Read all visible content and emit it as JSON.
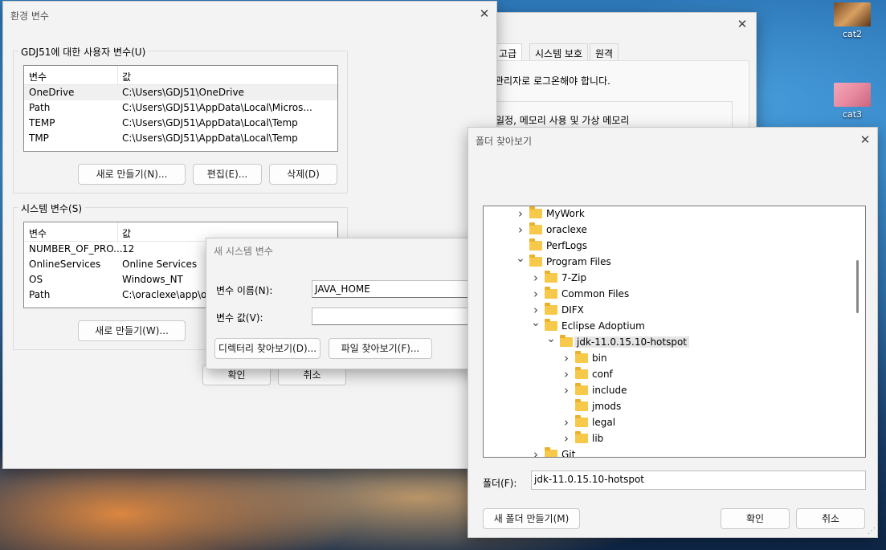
{
  "desktop": {
    "icons": [
      {
        "label": "cat2"
      },
      {
        "label": "cat3"
      }
    ]
  },
  "sysprops": {
    "tabs": [
      "고급",
      "시스템 보호",
      "원격"
    ],
    "admin_note": "관리자로 로그온해야 합니다.",
    "perf_note": "일정, 메모리 사용 및 가상 메모리"
  },
  "envvars": {
    "title": "환경 변수",
    "user_group_label": "GDJ51에 대한 사용자 변수(U)",
    "col_var": "변수",
    "col_val": "값",
    "user_rows": [
      {
        "name": "OneDrive",
        "value": "C:\\Users\\GDJ51\\OneDrive"
      },
      {
        "name": "Path",
        "value": "C:\\Users\\GDJ51\\AppData\\Local\\Micros..."
      },
      {
        "name": "TEMP",
        "value": "C:\\Users\\GDJ51\\AppData\\Local\\Temp"
      },
      {
        "name": "TMP",
        "value": "C:\\Users\\GDJ51\\AppData\\Local\\Temp"
      }
    ],
    "user_new": "새로 만들기(N)...",
    "user_edit": "편집(E)...",
    "user_delete": "삭제(D)",
    "sys_group_label": "시스템 변수(S)",
    "sys_rows": [
      {
        "name": "NUMBER_OF_PRO...",
        "value": "12"
      },
      {
        "name": "OnlineServices",
        "value": "Online Services"
      },
      {
        "name": "OS",
        "value": "Windows_NT"
      },
      {
        "name": "Path",
        "value": "C:\\oraclexe\\app\\or"
      }
    ],
    "sys_new": "새로 만들기(W)...",
    "ok": "확인",
    "cancel": "취소"
  },
  "newsysvar": {
    "title": "새 시스템 변수",
    "name_label": "변수 이름(N):",
    "name_value": "JAVA_HOME",
    "value_label": "변수 값(V):",
    "value_value": "",
    "browse_dir": "디렉터리 찾아보기(D)...",
    "browse_file": "파일 찾아보기(F)..."
  },
  "folderbrowse": {
    "title": "폴더 찾아보기",
    "tree": [
      {
        "name": "MyWork",
        "depth": 0,
        "chev": ">"
      },
      {
        "name": "oraclexe",
        "depth": 0,
        "chev": ">"
      },
      {
        "name": "PerfLogs",
        "depth": 0,
        "chev": ""
      },
      {
        "name": "Program Files",
        "depth": 0,
        "chev": "v"
      },
      {
        "name": "7-Zip",
        "depth": 1,
        "chev": ">"
      },
      {
        "name": "Common Files",
        "depth": 1,
        "chev": ">"
      },
      {
        "name": "DIFX",
        "depth": 1,
        "chev": ">"
      },
      {
        "name": "Eclipse Adoptium",
        "depth": 1,
        "chev": "v"
      },
      {
        "name": "jdk-11.0.15.10-hotspot",
        "depth": 2,
        "chev": "v",
        "selected": true
      },
      {
        "name": "bin",
        "depth": 3,
        "chev": ">"
      },
      {
        "name": "conf",
        "depth": 3,
        "chev": ">"
      },
      {
        "name": "include",
        "depth": 3,
        "chev": ">"
      },
      {
        "name": "jmods",
        "depth": 3,
        "chev": ""
      },
      {
        "name": "legal",
        "depth": 3,
        "chev": ">"
      },
      {
        "name": "lib",
        "depth": 3,
        "chev": ">"
      },
      {
        "name": "Git",
        "depth": 1,
        "chev": ">"
      }
    ],
    "folder_label": "폴더(F):",
    "folder_value": "jdk-11.0.15.10-hotspot",
    "new_folder": "새 폴더 만들기(M)",
    "ok": "확인",
    "cancel": "취소"
  }
}
